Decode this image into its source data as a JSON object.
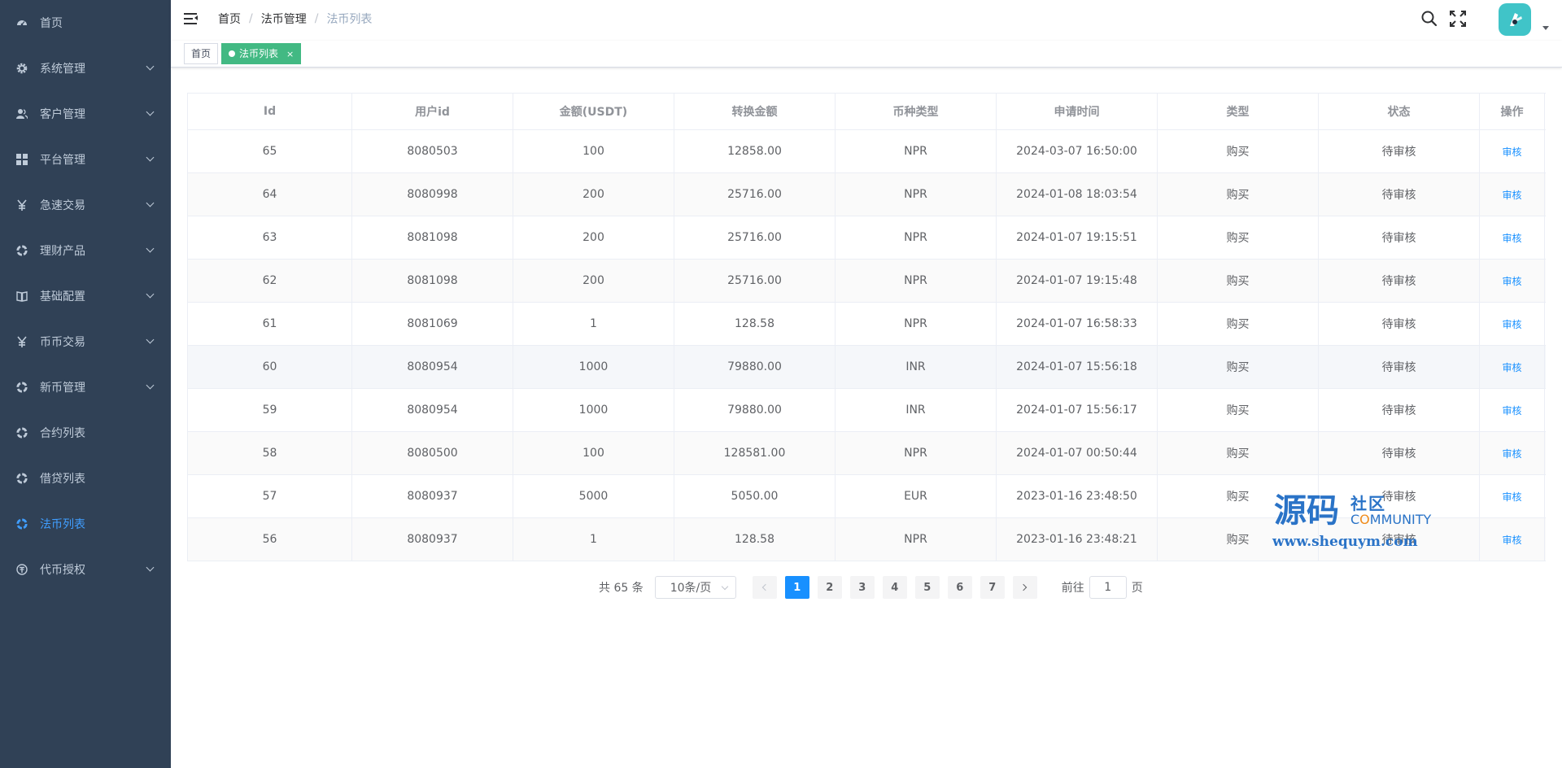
{
  "sidebar": {
    "items": [
      {
        "label": "首页",
        "icon": "dashboard-icon",
        "has_arrow": false,
        "active": false
      },
      {
        "label": "系统管理",
        "icon": "gear-icon",
        "has_arrow": true,
        "active": false
      },
      {
        "label": "客户管理",
        "icon": "users-icon",
        "has_arrow": true,
        "active": false
      },
      {
        "label": "平台管理",
        "icon": "grid-icon",
        "has_arrow": true,
        "active": false
      },
      {
        "label": "急速交易",
        "icon": "yen-icon",
        "has_arrow": true,
        "active": false
      },
      {
        "label": "理财产品",
        "icon": "circle-icon",
        "has_arrow": true,
        "active": false
      },
      {
        "label": "基础配置",
        "icon": "book-icon",
        "has_arrow": true,
        "active": false
      },
      {
        "label": "币币交易",
        "icon": "yen-icon",
        "has_arrow": true,
        "active": false
      },
      {
        "label": "新币管理",
        "icon": "circle-icon",
        "has_arrow": true,
        "active": false
      },
      {
        "label": "合约列表",
        "icon": "circle-icon",
        "has_arrow": false,
        "active": false
      },
      {
        "label": "借贷列表",
        "icon": "circle-icon",
        "has_arrow": false,
        "active": false
      },
      {
        "label": "法币列表",
        "icon": "circle-icon",
        "has_arrow": false,
        "active": true
      },
      {
        "label": "代币授权",
        "icon": "token-icon",
        "has_arrow": true,
        "active": false
      }
    ]
  },
  "breadcrumb": {
    "home": "首页",
    "parent": "法币管理",
    "current": "法币列表"
  },
  "tags": {
    "home": "首页",
    "active": "法币列表",
    "close": "×"
  },
  "colors": {
    "sidebar_bg": "#304156",
    "sidebar_text": "#bfcbd9",
    "active": "#409eff",
    "tag_active": "#42b983",
    "link": "#1890ff",
    "watermark": "#2a73c7"
  },
  "table": {
    "columns": [
      "Id",
      "用户id",
      "金额(USDT)",
      "转换金额",
      "币种类型",
      "申请时间",
      "类型",
      "状态",
      "操作"
    ],
    "rows": [
      {
        "id": "65",
        "uid": "8080503",
        "amount": "100",
        "converted": "12858.00",
        "currency": "NPR",
        "time": "2024-03-07 16:50:00",
        "type": "购买",
        "status": "待审核",
        "action": "审核"
      },
      {
        "id": "64",
        "uid": "8080998",
        "amount": "200",
        "converted": "25716.00",
        "currency": "NPR",
        "time": "2024-01-08 18:03:54",
        "type": "购买",
        "status": "待审核",
        "action": "审核"
      },
      {
        "id": "63",
        "uid": "8081098",
        "amount": "200",
        "converted": "25716.00",
        "currency": "NPR",
        "time": "2024-01-07 19:15:51",
        "type": "购买",
        "status": "待审核",
        "action": "审核"
      },
      {
        "id": "62",
        "uid": "8081098",
        "amount": "200",
        "converted": "25716.00",
        "currency": "NPR",
        "time": "2024-01-07 19:15:48",
        "type": "购买",
        "status": "待审核",
        "action": "审核"
      },
      {
        "id": "61",
        "uid": "8081069",
        "amount": "1",
        "converted": "128.58",
        "currency": "NPR",
        "time": "2024-01-07 16:58:33",
        "type": "购买",
        "status": "待审核",
        "action": "审核"
      },
      {
        "id": "60",
        "uid": "8080954",
        "amount": "1000",
        "converted": "79880.00",
        "currency": "INR",
        "time": "2024-01-07 15:56:18",
        "type": "购买",
        "status": "待审核",
        "action": "审核"
      },
      {
        "id": "59",
        "uid": "8080954",
        "amount": "1000",
        "converted": "79880.00",
        "currency": "INR",
        "time": "2024-01-07 15:56:17",
        "type": "购买",
        "status": "待审核",
        "action": "审核"
      },
      {
        "id": "58",
        "uid": "8080500",
        "amount": "100",
        "converted": "128581.00",
        "currency": "NPR",
        "time": "2024-01-07 00:50:44",
        "type": "购买",
        "status": "待审核",
        "action": "审核"
      },
      {
        "id": "57",
        "uid": "8080937",
        "amount": "5000",
        "converted": "5050.00",
        "currency": "EUR",
        "time": "2023-01-16 23:48:50",
        "type": "购买",
        "status": "待审核",
        "action": "审核"
      },
      {
        "id": "56",
        "uid": "8080937",
        "amount": "1",
        "converted": "128.58",
        "currency": "NPR",
        "time": "2023-01-16 23:48:21",
        "type": "购买",
        "status": "待审核",
        "action": "审核"
      }
    ]
  },
  "pagination": {
    "total": "共 65 条",
    "page_size": "10条/页",
    "pages": [
      "1",
      "2",
      "3",
      "4",
      "5",
      "6",
      "7"
    ],
    "current": "1",
    "goto_label": "前往",
    "goto_value": "1",
    "page_unit": "页"
  },
  "watermark": {
    "big": "源码",
    "small": "社区",
    "community_pre": "C",
    "community_o": "O",
    "community_post": "MMUNITY",
    "url": "www.shequym.com"
  }
}
